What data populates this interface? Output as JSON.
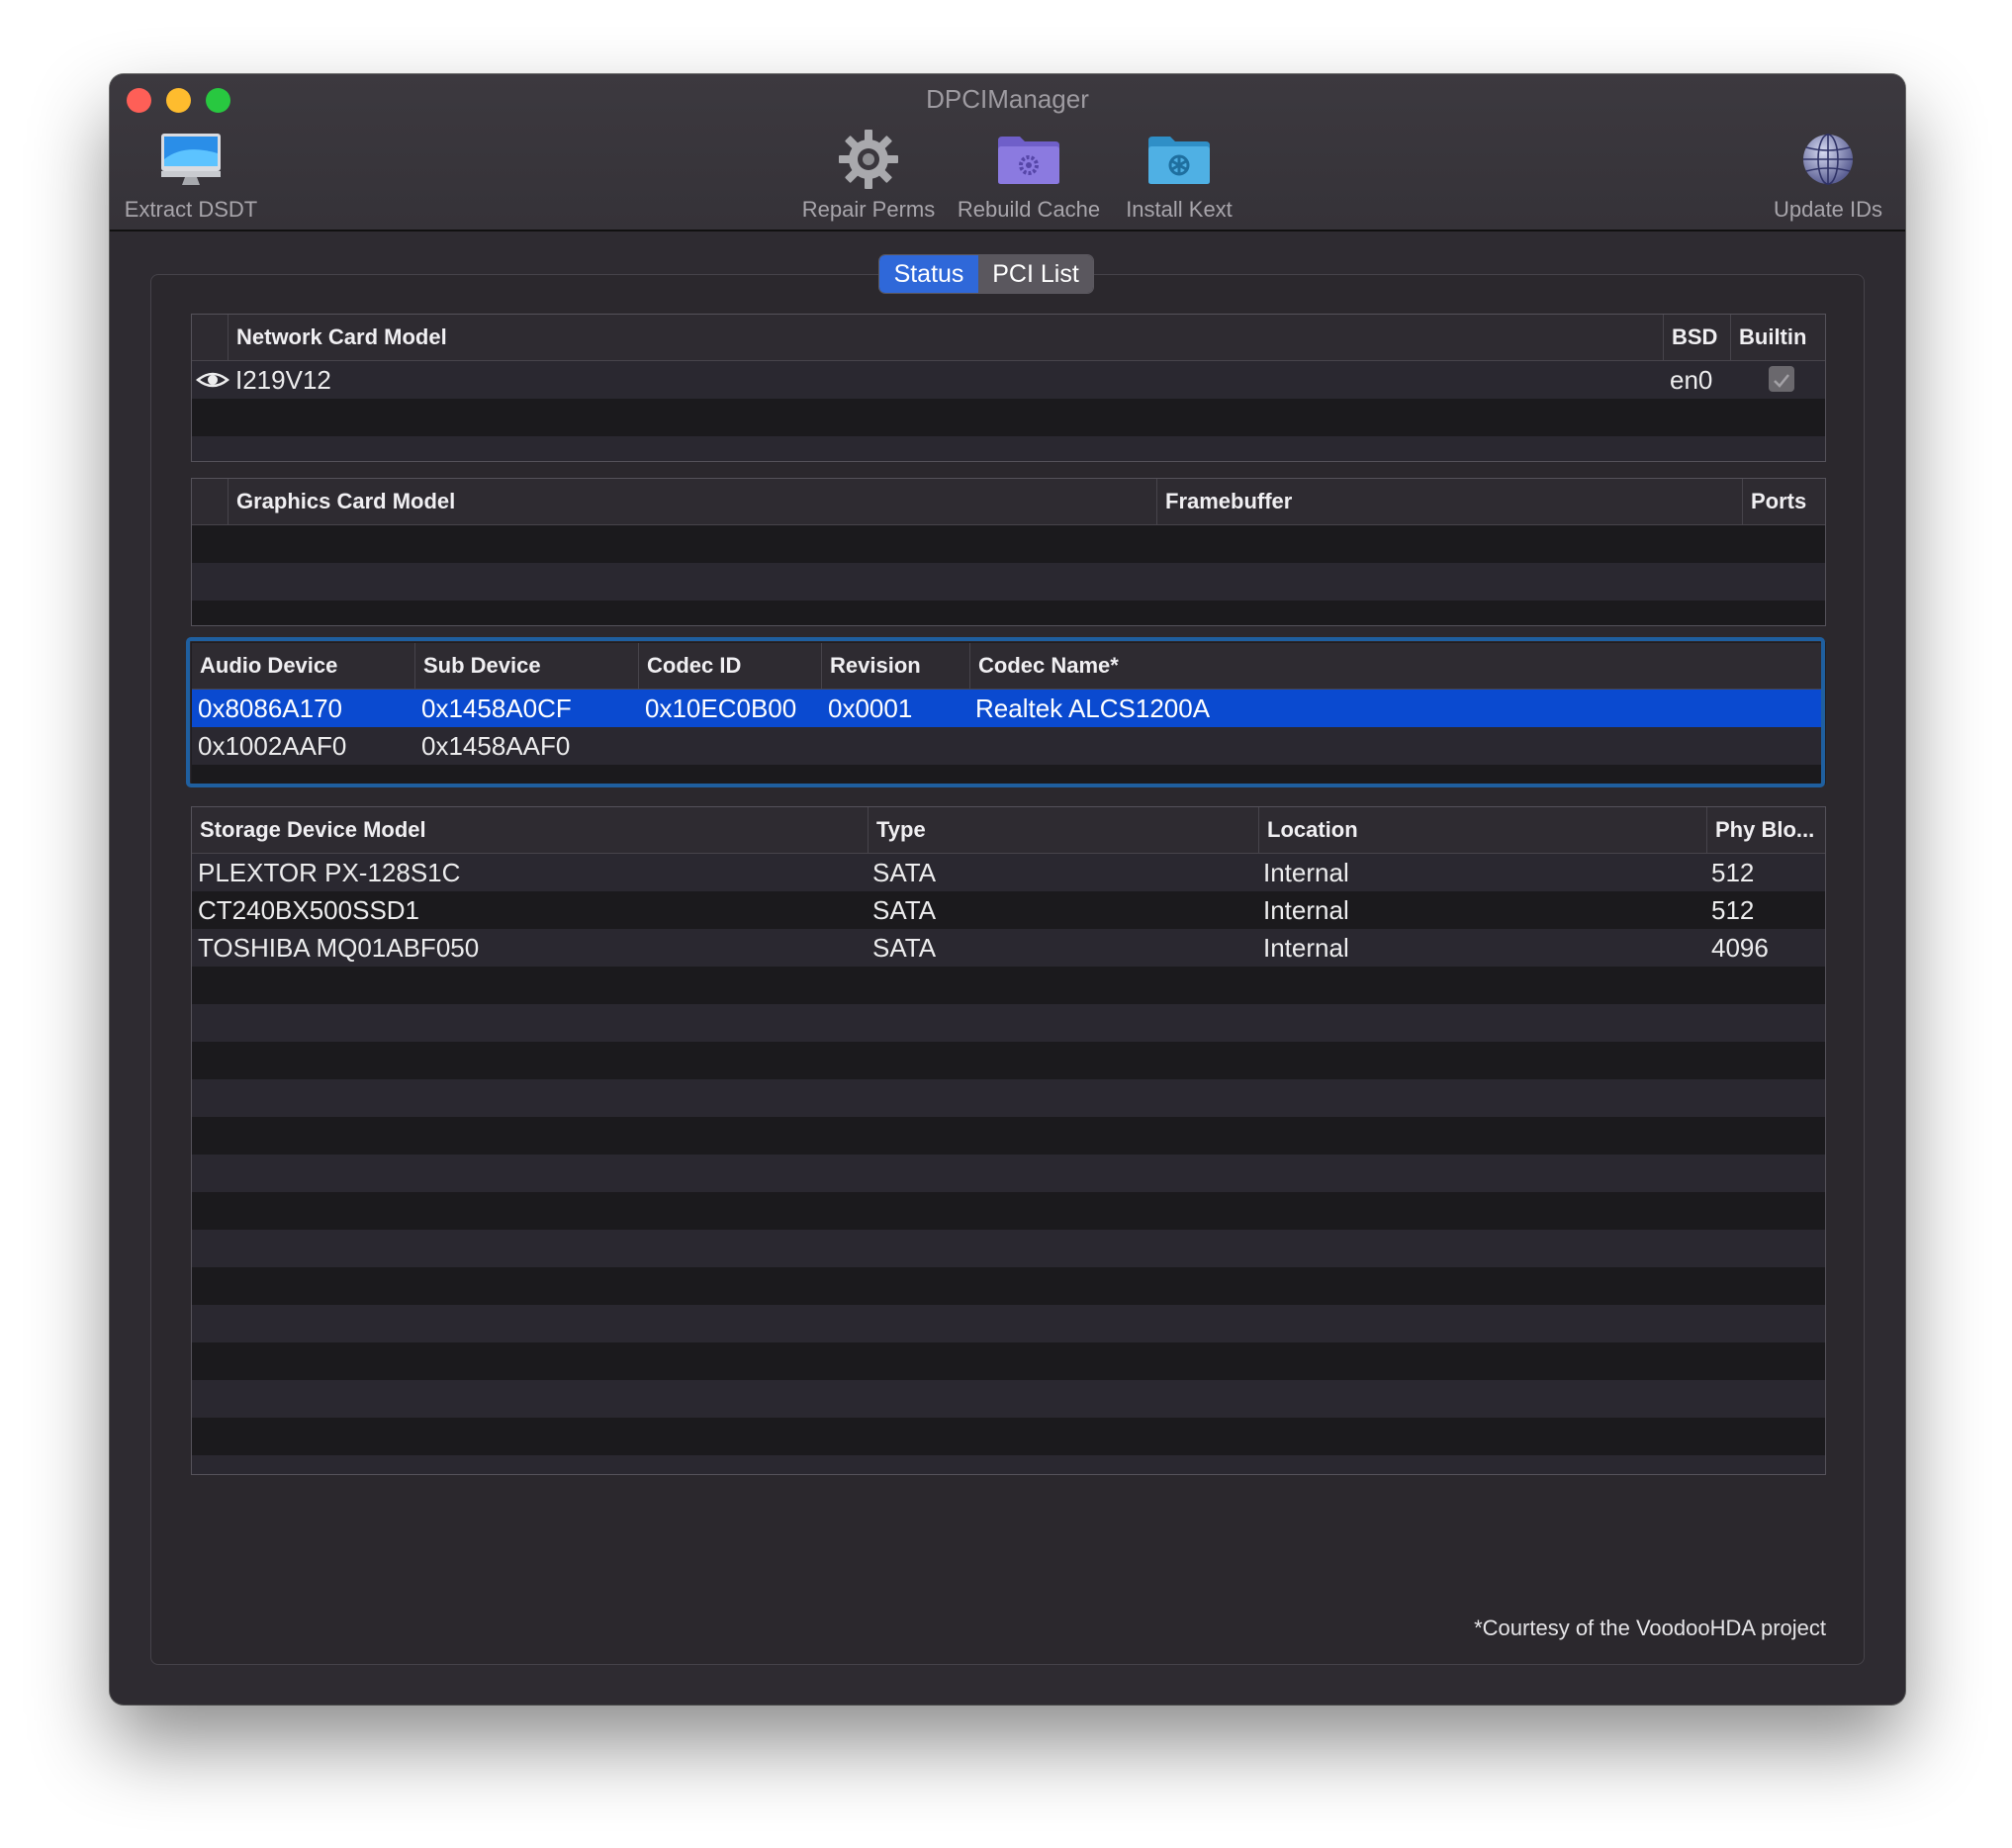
{
  "window": {
    "title": "DPCIManager"
  },
  "toolbar": {
    "extract": {
      "label": "Extract DSDT",
      "icon": "imac-icon"
    },
    "repair": {
      "label": "Repair Perms",
      "icon": "gear-icon"
    },
    "rebuild": {
      "label": "Rebuild Cache",
      "icon": "folder-gear-icon"
    },
    "install": {
      "label": "Install Kext",
      "icon": "folder-kext-icon"
    },
    "update": {
      "label": "Update IDs",
      "icon": "globe-icon"
    }
  },
  "tabs": {
    "status": "Status",
    "pci": "PCI List"
  },
  "network": {
    "headers": {
      "model": "Network Card Model",
      "bsd": "BSD",
      "builtin": "Builtin"
    },
    "rows": [
      {
        "model": "I219V12",
        "bsd": "en0",
        "builtin": true
      }
    ]
  },
  "graphics": {
    "headers": {
      "model": "Graphics Card Model",
      "framebuffer": "Framebuffer",
      "ports": "Ports"
    }
  },
  "audio": {
    "headers": {
      "device": "Audio Device",
      "sub": "Sub Device",
      "codec_id": "Codec ID",
      "revision": "Revision",
      "codec_name": "Codec Name*"
    },
    "rows": [
      {
        "device": "0x8086A170",
        "sub": "0x1458A0CF",
        "codec_id": "0x10EC0B00",
        "revision": "0x0001",
        "codec_name": "Realtek ALCS1200A"
      },
      {
        "device": "0x1002AAF0",
        "sub": "0x1458AAF0",
        "codec_id": "",
        "revision": "",
        "codec_name": ""
      }
    ]
  },
  "storage": {
    "headers": {
      "model": "Storage Device Model",
      "type": "Type",
      "location": "Location",
      "block": "Phy Blo..."
    },
    "rows": [
      {
        "model": "PLEXTOR PX-128S1C",
        "type": "SATA",
        "location": "Internal",
        "block": "512"
      },
      {
        "model": "CT240BX500SSD1",
        "type": "SATA",
        "location": "Internal",
        "block": "512"
      },
      {
        "model": "TOSHIBA MQ01ABF050",
        "type": "SATA",
        "location": "Internal",
        "block": "4096"
      }
    ]
  },
  "footnote": "*Courtesy of the VoodooHDA project",
  "colors": {
    "selection": "#0a4ad0",
    "tab_active": "#2f68d9",
    "window_bg": "#2e2b31"
  }
}
